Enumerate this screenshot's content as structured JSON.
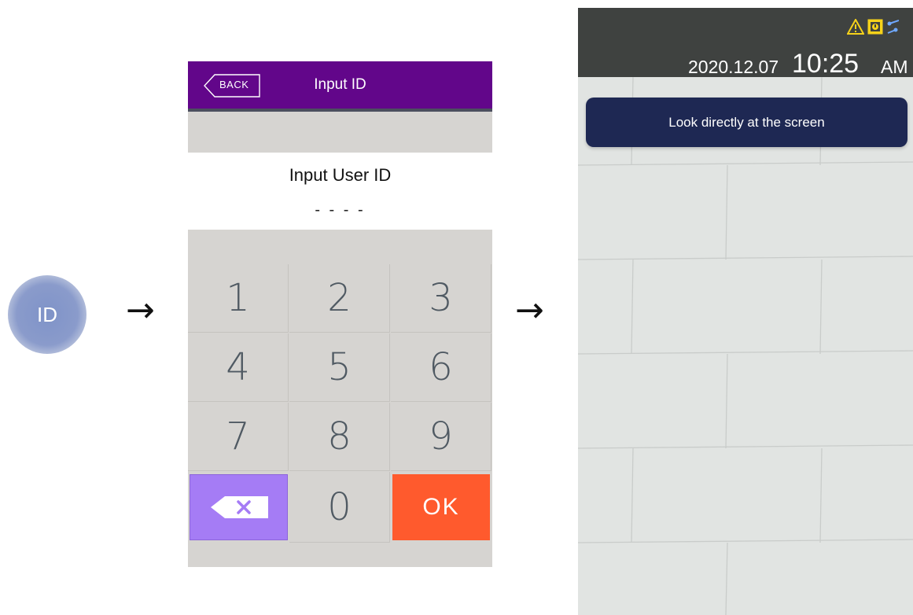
{
  "id_bubble": {
    "label": "ID"
  },
  "arrows": {
    "first": "→",
    "second": "→"
  },
  "keypad_screen": {
    "back_label": "BACK",
    "title": "Input ID",
    "prompt": "Input User ID",
    "entered_value": "- - - -",
    "keys": [
      {
        "name": "key-1",
        "label": "1"
      },
      {
        "name": "key-2",
        "label": "2"
      },
      {
        "name": "key-3",
        "label": "3"
      },
      {
        "name": "key-4",
        "label": "4"
      },
      {
        "name": "key-5",
        "label": "5"
      },
      {
        "name": "key-6",
        "label": "6"
      },
      {
        "name": "key-7",
        "label": "7"
      },
      {
        "name": "key-8",
        "label": "8"
      },
      {
        "name": "key-9",
        "label": "9"
      },
      {
        "name": "key-backspace",
        "label": "",
        "icon": "backspace-icon"
      },
      {
        "name": "key-0",
        "label": "0"
      },
      {
        "name": "key-ok",
        "label": "OK"
      }
    ],
    "colors": {
      "header": "#62068a",
      "pad": "#d6d4d1",
      "backspace": "#a57cf5",
      "ok": "#ff5a2d"
    }
  },
  "camera_screen": {
    "date": "2020.12.07",
    "time": "10:25",
    "ampm": "AM",
    "status_icons": [
      "warning-icon",
      "alert-icon",
      "network-icon"
    ],
    "banner_text": "Look directly at the screen",
    "colors": {
      "status_bar": "#3f4240",
      "banner": "#1e2853"
    }
  }
}
